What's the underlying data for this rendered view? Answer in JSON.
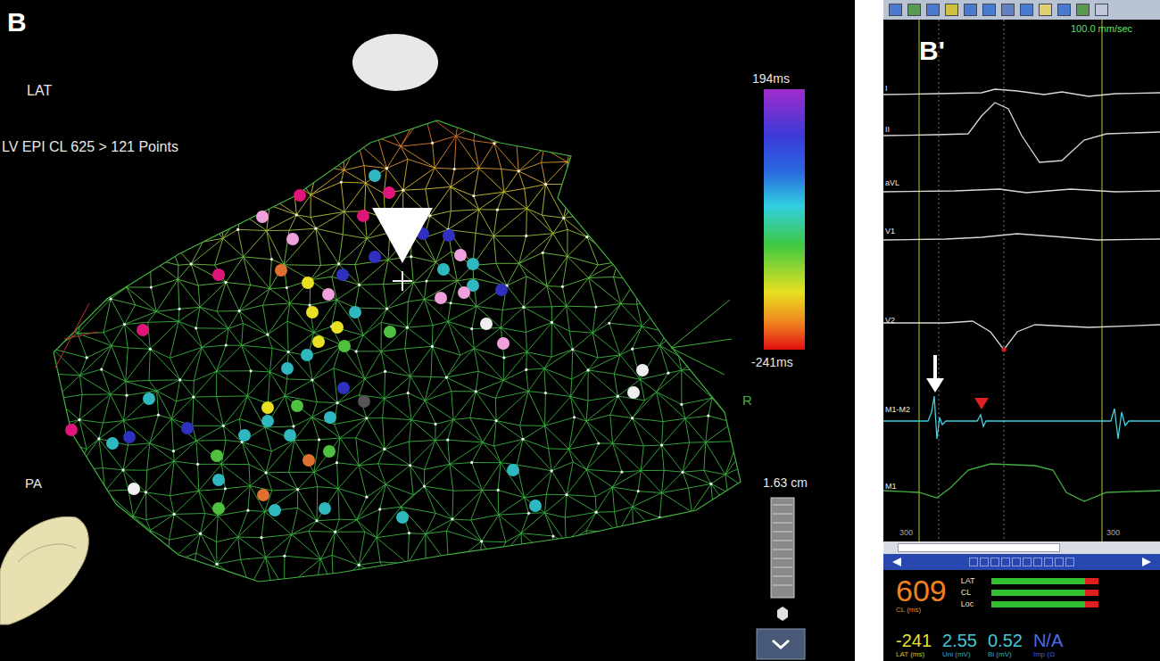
{
  "map": {
    "panel_label": "B",
    "map_label": "LAT",
    "map_title": "LV EPI CL 625 > 121 Points",
    "orientation_marker": "R",
    "view_label": "PA",
    "scale": "1.63 cm"
  },
  "color_scale": {
    "max": "194ms",
    "min": "-241ms"
  },
  "points": [
    {
      "color": "#30b8c0"
    },
    {
      "color": "#e0157a"
    },
    {
      "color": "#e0157a"
    },
    {
      "color": "#e0157a"
    },
    {
      "color": "#f0a0dc"
    },
    {
      "color": "#f0a0dc"
    },
    {
      "color": "#f0a0dc"
    },
    {
      "color": "#3030c0"
    },
    {
      "color": "#3030c0"
    },
    {
      "color": "#3030c0"
    },
    {
      "color": "#f0a0dc"
    },
    {
      "color": "#30b8c0"
    },
    {
      "color": "#30b8c0"
    },
    {
      "color": "#30b8c0"
    },
    {
      "color": "#f0a0dc"
    },
    {
      "color": "#f0a0dc"
    },
    {
      "color": "#3030c0"
    },
    {
      "color": "#e8e020"
    },
    {
      "color": "#f0a0dc"
    },
    {
      "color": "#e0157a"
    },
    {
      "color": "#e07030"
    },
    {
      "color": "#3030c0"
    },
    {
      "color": "#f0f0f0"
    },
    {
      "color": "#f0a0dc"
    },
    {
      "color": "#e8e020"
    },
    {
      "color": "#e8e020"
    },
    {
      "color": "#30b8c0"
    },
    {
      "color": "#50c040"
    },
    {
      "color": "#e8e020"
    },
    {
      "color": "#50c040"
    },
    {
      "color": "#30b8c0"
    },
    {
      "color": "#e0157a"
    },
    {
      "color": "#30b8c0"
    },
    {
      "color": "#3030c0"
    },
    {
      "color": "#e8e020"
    },
    {
      "color": "#50c040"
    },
    {
      "color": "#555555"
    },
    {
      "color": "#30b8c0"
    },
    {
      "color": "#30b8c0"
    },
    {
      "color": "#30b8c0"
    },
    {
      "color": "#3030c0"
    },
    {
      "color": "#30b8c0"
    },
    {
      "color": "#30b8c0"
    },
    {
      "color": "#3030c0"
    },
    {
      "color": "#30b8c0"
    },
    {
      "color": "#e0157a"
    },
    {
      "color": "#50c040"
    },
    {
      "color": "#50c040"
    },
    {
      "color": "#e07030"
    },
    {
      "color": "#f0f0f0"
    },
    {
      "color": "#30b8c0"
    },
    {
      "color": "#e07030"
    },
    {
      "color": "#30b8c0"
    },
    {
      "color": "#30b8c0"
    },
    {
      "color": "#30b8c0"
    },
    {
      "color": "#30b8c0"
    },
    {
      "color": "#30b8c0"
    },
    {
      "color": "#50c040"
    },
    {
      "color": "#f0f0f0"
    },
    {
      "color": "#f0f0f0"
    }
  ],
  "egm": {
    "panel_label": "B'",
    "sweep_speed": "100.0 mm/sec",
    "channels": [
      {
        "name": "I",
        "color": "#d8d8d8"
      },
      {
        "name": "II",
        "color": "#d8d8d8"
      },
      {
        "name": "aVL",
        "color": "#d8d8d8"
      },
      {
        "name": "V1",
        "color": "#d8d8d8"
      },
      {
        "name": "V2",
        "color": "#d8d8d8"
      },
      {
        "name": "M1-M2",
        "color": "#40d0e0"
      },
      {
        "name": "M1",
        "color": "#40b040"
      }
    ],
    "time_marks": [
      "300",
      "300"
    ]
  },
  "readout": {
    "cycle_length": "609",
    "cycle_length_label": "CL (ms)",
    "quality": [
      {
        "label": "LAT",
        "level": 0.88
      },
      {
        "label": "CL",
        "level": 0.88
      },
      {
        "label": "Loc",
        "level": 0.88
      }
    ],
    "values": [
      {
        "value": "-241",
        "label": "LAT (ms)",
        "color": "#e8e030"
      },
      {
        "value": "2.55",
        "label": "Uni (mV)",
        "color": "#40c8d8"
      },
      {
        "value": "0.52",
        "label": "Bi (mV)",
        "color": "#40c8d8"
      },
      {
        "value": "N/A",
        "label": "Imp (Ω",
        "color": "#4a6cf0"
      }
    ]
  }
}
